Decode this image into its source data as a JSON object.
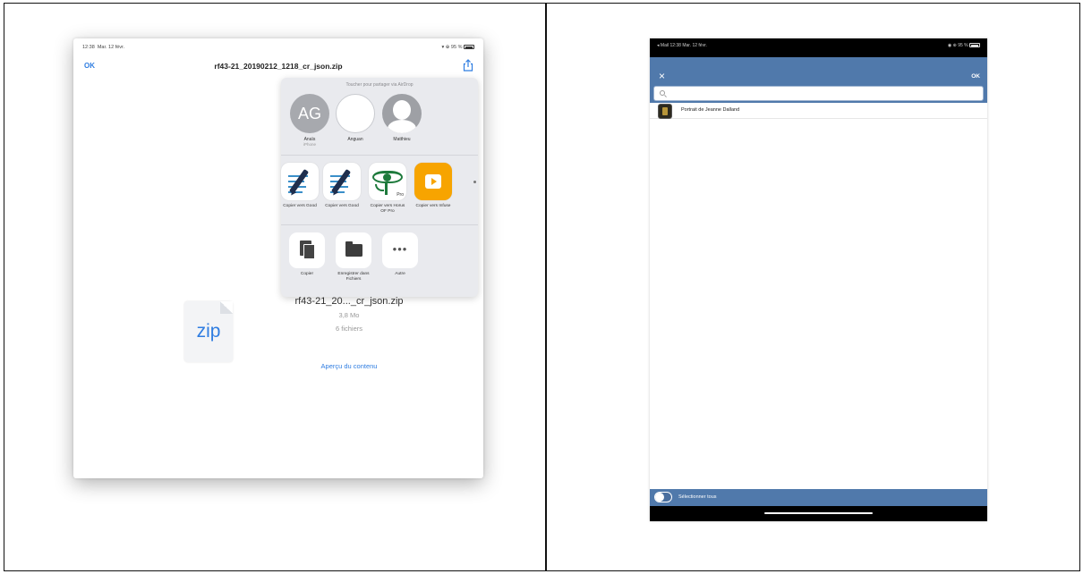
{
  "left_screen": {
    "status": {
      "time": "12:38",
      "date": "Mar. 12 févr.",
      "battery": "▾ ⊕ 95 %"
    },
    "nav": {
      "ok": "OK",
      "title": "rf43-21_20190212_1218_cr_json.zip"
    },
    "share_sheet": {
      "airdrop_hint": "Toucher pour partager via AirDrop",
      "people": [
        {
          "initials": "AG",
          "name": "Anaïs",
          "sub": "iPhone"
        },
        {
          "initials": "",
          "name": "Anguan",
          "sub": ""
        },
        {
          "initials": "",
          "name": "Matthieu",
          "sub": ""
        }
      ],
      "apps": [
        {
          "label": "Copier vers Good"
        },
        {
          "label": "Copier vers Good"
        },
        {
          "label": "Copier vers Horus OF Pro",
          "tag": "Pro"
        },
        {
          "label": "Copier vers Infuse"
        }
      ],
      "actions": [
        {
          "label": "Copier"
        },
        {
          "label": "Enregistrer dans Fichiers"
        },
        {
          "label": "Autre"
        }
      ]
    },
    "file": {
      "icon_text": "zip",
      "name": "rf43-21_20..._cr_json.zip",
      "size": "3,8 Mo",
      "count": "6 fichiers",
      "preview_link": "Aperçu du contenu"
    }
  },
  "right_screen": {
    "status": {
      "left": "◂ Mail  12:38  Mar. 12 févr.",
      "right": "◉ ⊕ 95 %"
    },
    "nav": {
      "close": "×",
      "ok": "OK"
    },
    "list": [
      {
        "label": "Portrait de Jeanne Dalland"
      }
    ],
    "bottom": {
      "select_all": "Sélectionner tous"
    }
  },
  "colors": {
    "ios_blue": "#2f7de1",
    "nav_blue": "#5079ab",
    "infuse_orange": "#f7a400",
    "horus_green": "#1e7a3c"
  }
}
